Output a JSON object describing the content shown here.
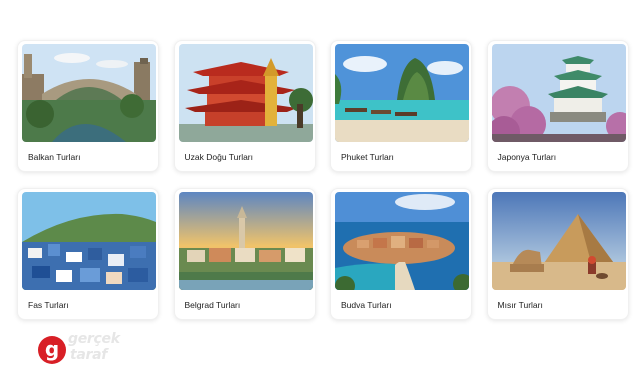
{
  "tours": [
    {
      "label": "Balkan Turları",
      "icon": "bridge-river-photo"
    },
    {
      "label": "Uzak Doğu Turları",
      "icon": "pagoda-temple-photo"
    },
    {
      "label": "Phuket Turları",
      "icon": "tropical-beach-photo"
    },
    {
      "label": "Japonya Turları",
      "icon": "japanese-castle-photo"
    },
    {
      "label": "Fas Turları",
      "icon": "blue-city-photo"
    },
    {
      "label": "Belgrad Turları",
      "icon": "city-sunset-photo"
    },
    {
      "label": "Budva Turları",
      "icon": "island-sea-photo"
    },
    {
      "label": "Mısır Turları",
      "icon": "pyramid-desert-photo"
    }
  ],
  "watermark": {
    "brand": "gerçek taraf",
    "icon": "gt-logo-icon",
    "accent": "#d81f26"
  }
}
